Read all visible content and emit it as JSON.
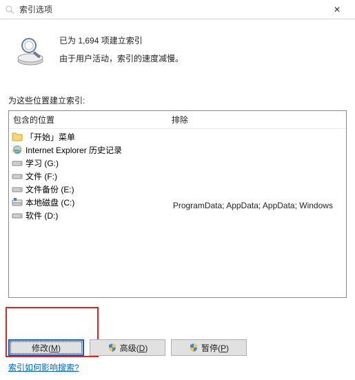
{
  "titlebar": {
    "title": "索引选项",
    "close": "✕"
  },
  "info": {
    "line1": "已为 1,694 项建立索引",
    "line2": "由于用户活动，索引的速度减慢。"
  },
  "section_label": "为这些位置建立索引:",
  "columns": {
    "included": "包含的位置",
    "excluded": "排除"
  },
  "locations": [
    {
      "icon": "folder",
      "label": "「开始」菜单",
      "exclude": ""
    },
    {
      "icon": "ie",
      "label": "Internet Explorer 历史记录",
      "exclude": ""
    },
    {
      "icon": "drive",
      "label": "学习 (G:)",
      "exclude": ""
    },
    {
      "icon": "drive",
      "label": "文件 (F:)",
      "exclude": ""
    },
    {
      "icon": "drive",
      "label": "文件备份 (E:)",
      "exclude": ""
    },
    {
      "icon": "drive-sys",
      "label": "本地磁盘 (C:)",
      "exclude": "ProgramData; AppData; AppData; Windows"
    },
    {
      "icon": "drive",
      "label": "软件 (D:)",
      "exclude": ""
    }
  ],
  "buttons": {
    "modify": "修改(",
    "modify_accel": "M",
    "modify_end": ")",
    "advanced": "高级(",
    "advanced_accel": "D",
    "advanced_end": ")",
    "pause": "暂停(",
    "pause_accel": "P",
    "pause_end": ")"
  },
  "help_link": "索引如何影响搜索?"
}
